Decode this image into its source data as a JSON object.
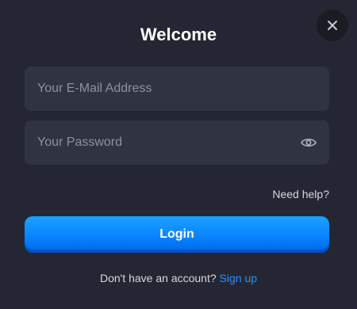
{
  "modal": {
    "title": "Welcome",
    "close_icon": "close-icon"
  },
  "form": {
    "email": {
      "value": "",
      "placeholder": "Your E-Mail Address"
    },
    "password": {
      "value": "",
      "placeholder": "Your Password",
      "toggle_icon": "eye-icon"
    },
    "help_link": "Need help?",
    "login_label": "Login"
  },
  "footer": {
    "prompt": "Don't have an account?",
    "signup_link": "Sign up"
  },
  "colors": {
    "background": "#242733",
    "field_background": "#2f3342",
    "accent": "#0a84ff",
    "link": "#2f8dff"
  }
}
